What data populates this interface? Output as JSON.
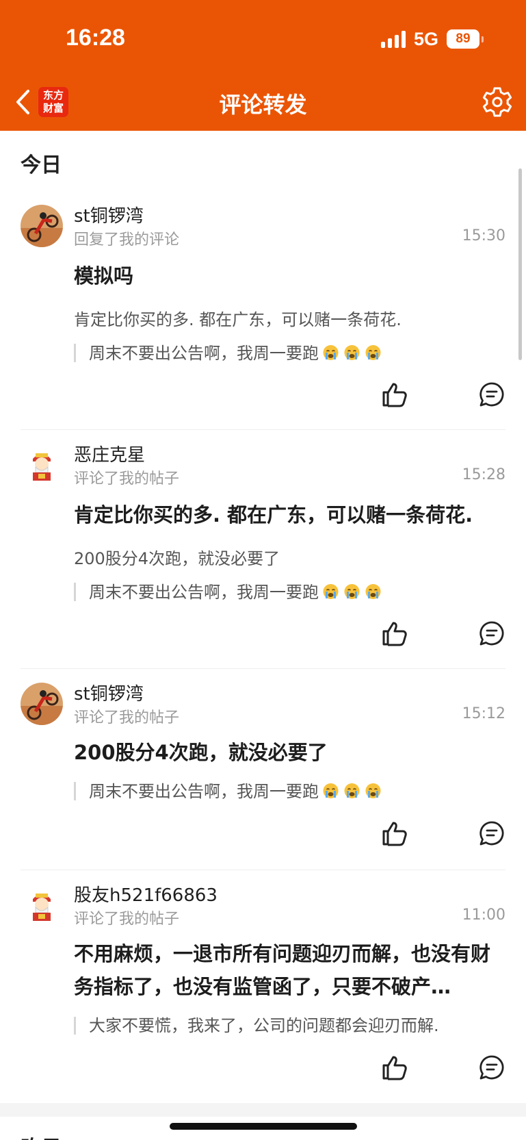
{
  "status_bar": {
    "time": "16:28",
    "network": "5G",
    "battery": "89"
  },
  "nav": {
    "title": "评论转发",
    "logo_text": "东方财富",
    "back_icon": "chevron-left-icon",
    "settings_icon": "gear-icon"
  },
  "brand_color": "#ea5505",
  "section_today": "今日",
  "section_next": "昨日",
  "items": [
    {
      "user": "st铜锣湾",
      "action": "回复了我的评论",
      "time": "15:30",
      "main": "模拟吗",
      "sub": "肯定比你买的多. 都在广东，可以赌一条荷花.",
      "quote": "周末不要出公告啊，我周一要跑",
      "quote_emoji": "crying-face-icon"
    },
    {
      "user": "恶庄克星",
      "action": "评论了我的帖子",
      "time": "15:28",
      "main": "肯定比你买的多. 都在广东，可以赌一条荷花.",
      "sub": "200股分4次跑，就没必要了",
      "quote": "周末不要出公告啊，我周一要跑",
      "quote_emoji": "crying-face-icon"
    },
    {
      "user": "st铜锣湾",
      "action": "评论了我的帖子",
      "time": "15:12",
      "main": "200股分4次跑，就没必要了",
      "quote": "周末不要出公告啊，我周一要跑",
      "quote_emoji": "crying-face-icon"
    },
    {
      "user": "股友h521f66863",
      "action": "评论了我的帖子",
      "time": "11:00",
      "main": "不用麻烦，一退市所有问题迎刃而解，也没有财务指标了，也没有监管函了，只要不破产…",
      "quote": "大家不要慌，我来了，公司的问题都会迎刃而解."
    }
  ]
}
